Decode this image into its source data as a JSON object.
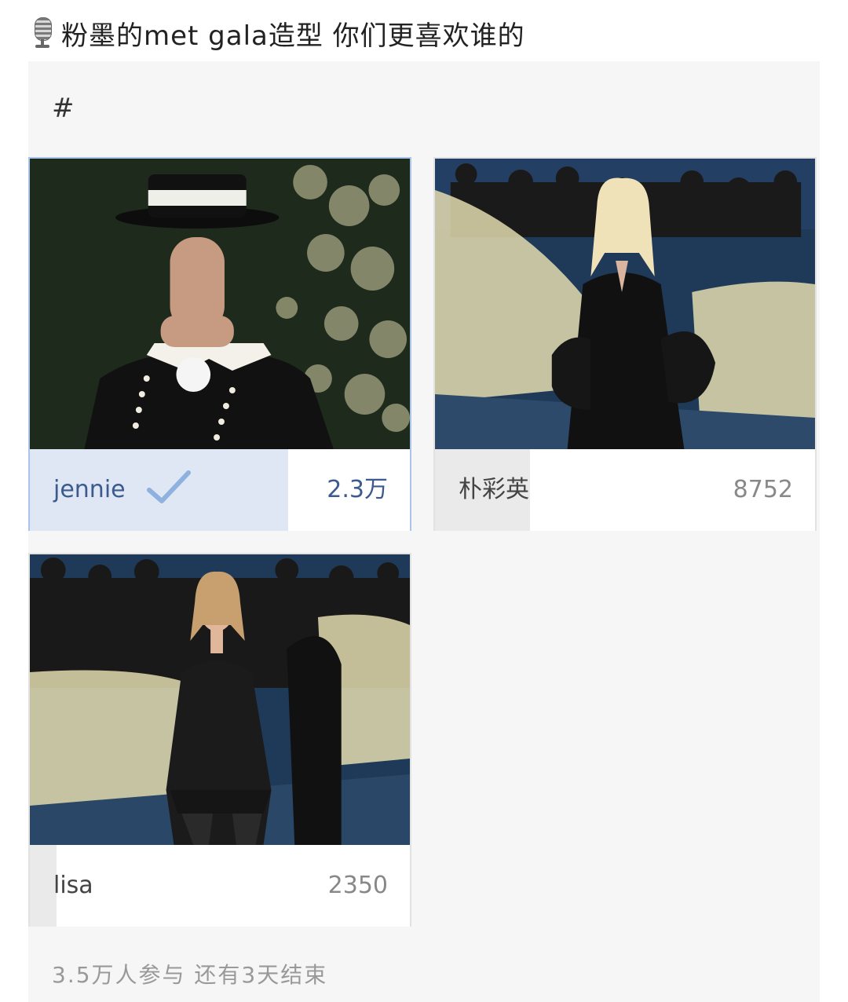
{
  "title": "粉墨的met gala造型 你们更喜欢谁的",
  "hashtag": "#",
  "options": [
    {
      "name": "jennie",
      "count": "2.3万",
      "selected": true,
      "share": 0.68
    },
    {
      "name": "朴彩英",
      "count": "8752",
      "selected": false,
      "share": 0.25
    },
    {
      "name": "lisa",
      "count": "2350",
      "selected": false,
      "share": 0.07
    }
  ],
  "footer": "3.5万人参与  还有3天结束",
  "icons": {
    "title": "microphone-icon",
    "selected": "checkmark-icon"
  },
  "colors": {
    "selected_fill": "#dfe6f4",
    "selected_border": "#a9c6ea",
    "accent_text": "#3c5a8e"
  }
}
